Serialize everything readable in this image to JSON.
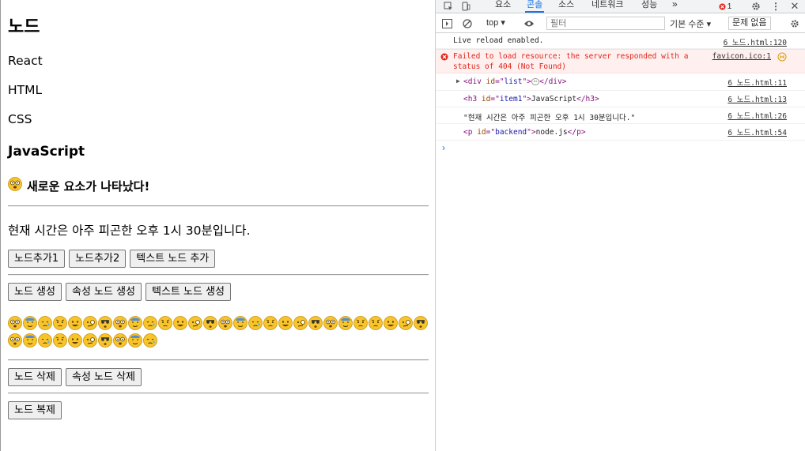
{
  "page": {
    "title": "노드",
    "paragraphs": [
      "React",
      "HTML",
      "CSS"
    ],
    "item1": "JavaScript",
    "new_heading": "새로운 요소가 나타났다!",
    "time_text": "현재 시간은 아주 피곤한 오후 1시 30분입니다.",
    "buttons_row1": [
      "노드추가1",
      "노드추가2",
      "텍스트 노드 추가"
    ],
    "buttons_row2": [
      "노드 생성",
      "속성 노드 생성",
      "텍스트 노드 생성"
    ],
    "buttons_row3": [
      "노드 삭제",
      "속성 노드 삭제"
    ],
    "buttons_row4": [
      "노드 복제"
    ],
    "emoji_count": 38
  },
  "devtools": {
    "tabs": [
      "요소",
      "콘솔",
      "소스",
      "네트워크",
      "성능"
    ],
    "active_tab": "콘솔",
    "error_count": "1",
    "context": "top",
    "filter_placeholder": "필터",
    "levels": "기본 수준",
    "issues": "문제 없음",
    "logs": [
      {
        "text": "Live reload enabled.",
        "source": "6 노드.html:120"
      },
      {
        "text": "Failed to load resource: the server responded with a",
        "text2": "status of 404 (Not Found)",
        "source": "favicon.ico:1"
      },
      {
        "tag": "div",
        "attr": "id",
        "value": "list",
        "source": "6 노드.html:11"
      },
      {
        "tag": "h3",
        "attr": "id",
        "value": "item1",
        "inner": "JavaScript",
        "source": "6 노드.html:13"
      },
      {
        "text": "\"현재 시간은 아주 피곤한 오후 1시 30분입니다.\"",
        "source": "6 노드.html:26"
      },
      {
        "tag": "p",
        "attr": "id",
        "value": "backend",
        "inner": "node.js",
        "source": "6 노드.html:54"
      }
    ]
  }
}
